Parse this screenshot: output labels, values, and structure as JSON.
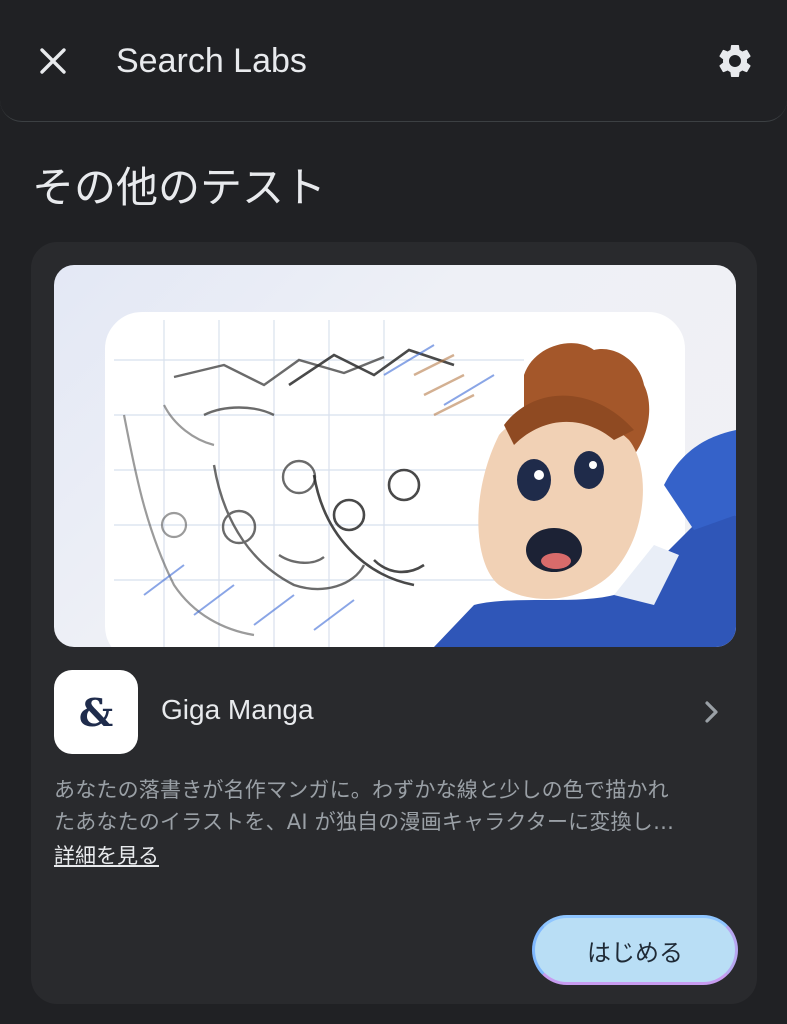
{
  "header": {
    "title": "Search Labs",
    "close_icon": "close-icon",
    "settings_icon": "gear-icon"
  },
  "section": {
    "title": "その他のテスト"
  },
  "card": {
    "hero_image": "manga-illustration",
    "app_icon_glyph": "&",
    "app_name": "Giga Manga",
    "description_line1": "あなたの落書きが名作マンガに。わずかな線と少しの色で描かれ",
    "description_line2": "たあなたのイラストを、AI が独自の漫画キャラクターに変換し…",
    "more_link": "詳細を見る",
    "start_button": "はじめる"
  },
  "colors": {
    "background": "#202124",
    "card": "#292a2d",
    "button": "#b9def5"
  }
}
